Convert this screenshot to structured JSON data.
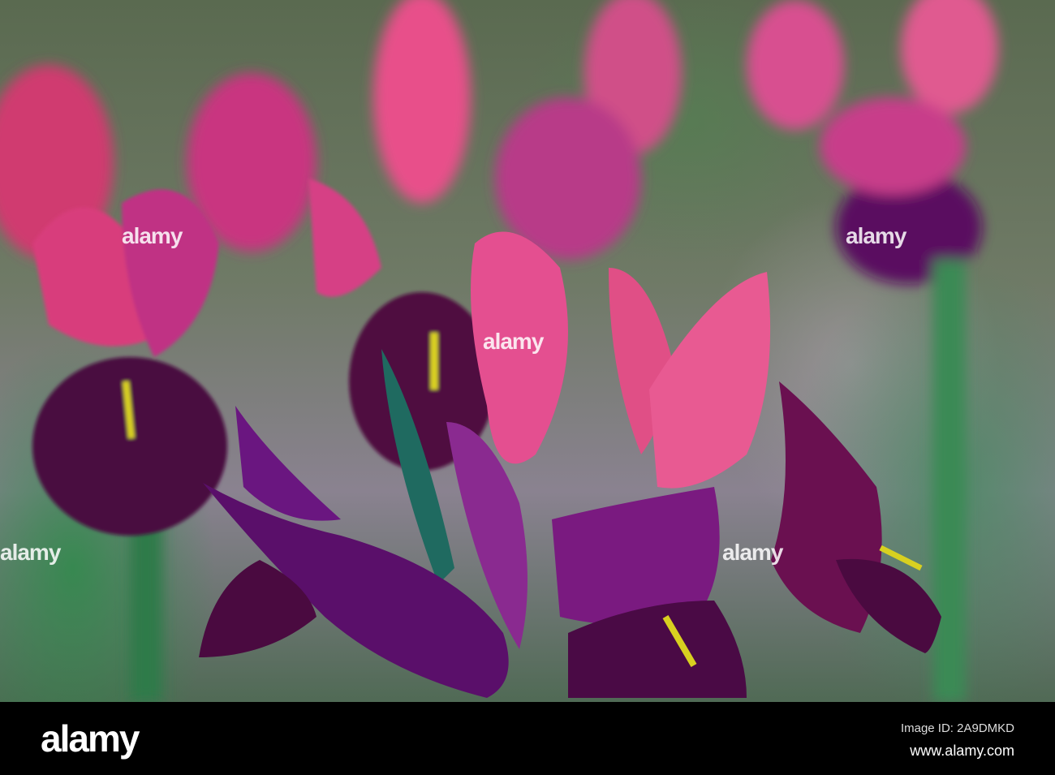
{
  "photo": {
    "subject": "purple-pink iris flowers",
    "watermark_text": "alamy",
    "colors": {
      "petal_pink": "#e0407a",
      "petal_purple": "#6a1050",
      "leaf_green": "#2a7a5a",
      "stamen_yellow": "#d8d020"
    }
  },
  "footer": {
    "logo": "alamy",
    "image_id": "Image ID: 2A9DMKD",
    "website": "www.alamy.com"
  }
}
